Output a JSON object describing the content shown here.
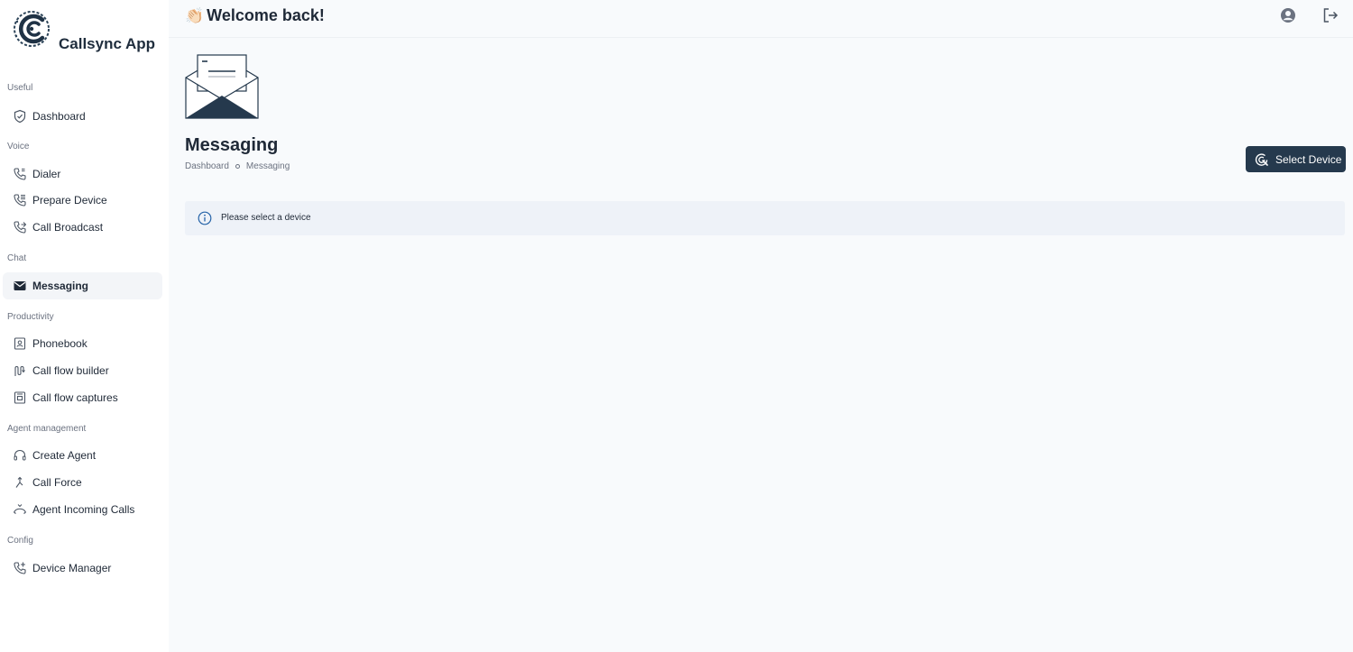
{
  "brand": {
    "name": "Callsync App"
  },
  "header": {
    "welcome_emoji": "👏🏻",
    "welcome_text": "Welcome back!"
  },
  "sidebar": {
    "sections": [
      {
        "title": "Useful",
        "items": [
          {
            "label": "Dashboard",
            "icon": "shield-check-icon"
          }
        ]
      },
      {
        "title": "Voice",
        "items": [
          {
            "label": "Dialer",
            "icon": "phone-icon"
          },
          {
            "label": "Prepare Device",
            "icon": "phone-lines-icon"
          },
          {
            "label": "Call Broadcast",
            "icon": "phone-forward-icon"
          }
        ]
      },
      {
        "title": "Chat",
        "items": [
          {
            "label": "Messaging",
            "icon": "envelope-icon",
            "active": true
          }
        ]
      },
      {
        "title": "Productivity",
        "items": [
          {
            "label": "Phonebook",
            "icon": "contact-book-icon"
          },
          {
            "label": "Call flow builder",
            "icon": "flow-icon"
          },
          {
            "label": "Call flow captures",
            "icon": "capture-icon"
          }
        ]
      },
      {
        "title": "Agent management",
        "items": [
          {
            "label": "Create Agent",
            "icon": "headset-icon"
          },
          {
            "label": "Call Force",
            "icon": "merge-arrow-icon"
          },
          {
            "label": "Agent Incoming Calls",
            "icon": "incoming-calls-icon"
          }
        ]
      },
      {
        "title": "Config",
        "items": [
          {
            "label": "Device Manager",
            "icon": "phone-plus-icon"
          }
        ]
      }
    ]
  },
  "main": {
    "title": "Messaging",
    "breadcrumb": [
      "Dashboard",
      "Messaging"
    ],
    "select_device_label": "Select Device",
    "alert_text": "Please select a device"
  },
  "colors": {
    "primary": "#25394d",
    "background": "#f8fafc",
    "sidebar": "#ffffff",
    "alert_bg": "#eef2f8"
  }
}
